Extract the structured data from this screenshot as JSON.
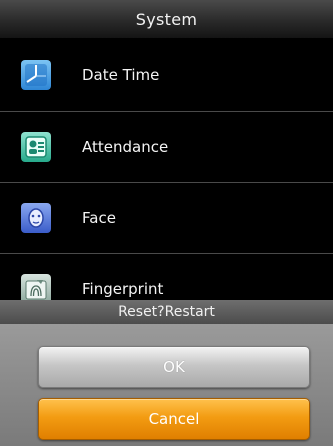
{
  "header": {
    "title": "System"
  },
  "menu": {
    "items": [
      {
        "label": "Date Time",
        "icon": "clock-icon"
      },
      {
        "label": "Attendance",
        "icon": "attendance-icon"
      },
      {
        "label": "Face",
        "icon": "face-icon"
      },
      {
        "label": "Fingerprint",
        "icon": "fingerprint-icon"
      }
    ]
  },
  "dialog": {
    "title": "Reset?Restart",
    "ok_label": "OK",
    "cancel_label": "Cancel"
  },
  "colors": {
    "cancel_button": "#f39c12",
    "ok_button": "#c6c6c6",
    "background": "#000000"
  }
}
